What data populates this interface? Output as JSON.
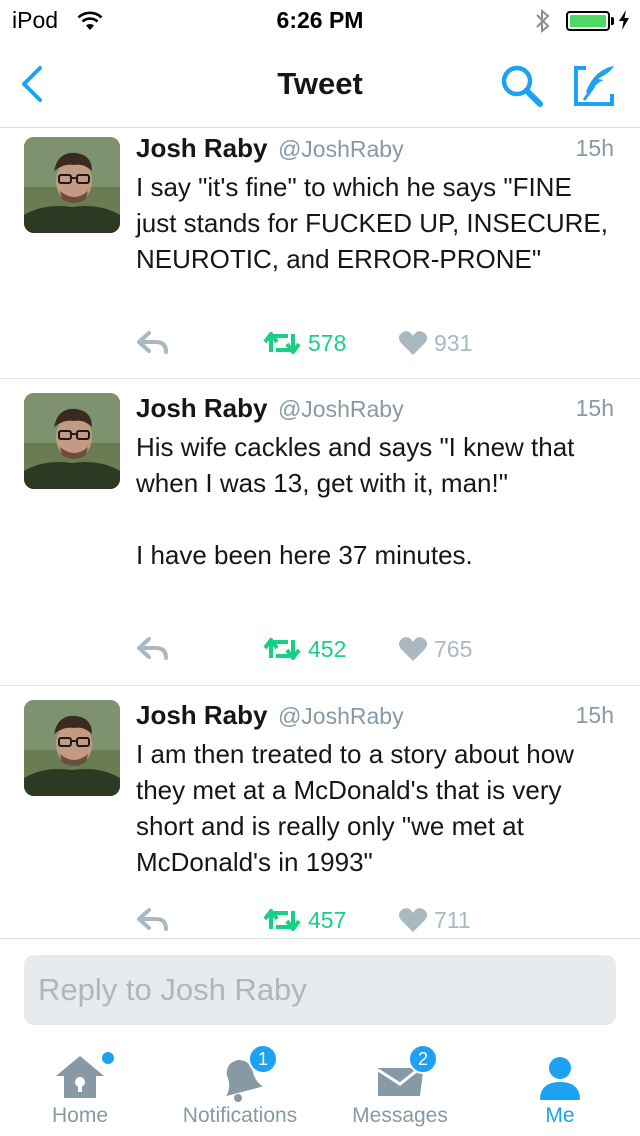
{
  "status_bar": {
    "carrier": "iPod",
    "time": "6:26 PM",
    "battery_level": 1.0
  },
  "nav": {
    "title": "Tweet",
    "back_icon": "chevron-left-icon",
    "search_icon": "search-icon",
    "compose_icon": "compose-icon"
  },
  "tweets": [
    {
      "name": "Josh Raby",
      "handle": "@JoshRaby",
      "time": "15h",
      "text": "I say \"it's fine\" to which he says \"FINE just stands for FUCKED UP, INSECURE, NEUROTIC, and ERROR-PRONE\"",
      "retweets": "578",
      "likes": "931"
    },
    {
      "name": "Josh Raby",
      "handle": "@JoshRaby",
      "time": "15h",
      "text": "His wife cackles and says \"I knew that when I was 13, get with it, man!\"\n\nI have been here 37 minutes.",
      "retweets": "452",
      "likes": "765"
    },
    {
      "name": "Josh Raby",
      "handle": "@JoshRaby",
      "time": "15h",
      "text": "I am then treated to a story about how they met at a McDonald's that is very short and is really only \"we met at McDonald's in 1993\"",
      "retweets": "457",
      "likes": "711"
    }
  ],
  "reply": {
    "placeholder": "Reply to Josh Raby"
  },
  "tabs": [
    {
      "label": "Home",
      "icon": "home-icon",
      "indicator": "dot"
    },
    {
      "label": "Notifications",
      "icon": "bell-icon",
      "badge": "1"
    },
    {
      "label": "Messages",
      "icon": "envelope-icon",
      "badge": "2"
    },
    {
      "label": "Me",
      "icon": "person-icon",
      "active": true
    }
  ],
  "colors": {
    "accent": "#1da1f2",
    "retweet": "#19cf86",
    "muted": "#8899a6",
    "battery": "#4cd964"
  }
}
